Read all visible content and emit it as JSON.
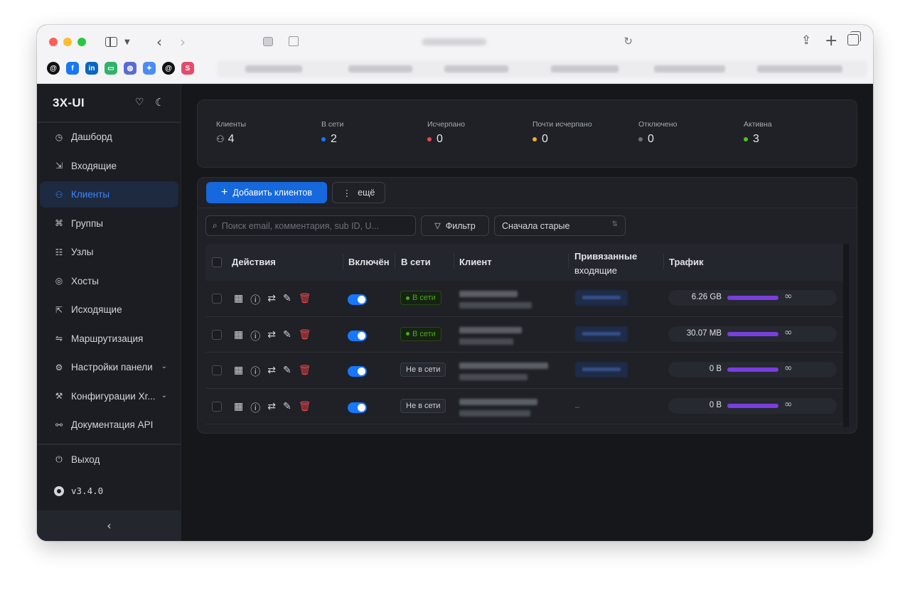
{
  "browser": {
    "bookmarks": [
      {
        "icon": "threads-icon",
        "color": "#111111",
        "glyph": "@"
      },
      {
        "icon": "facebook-icon",
        "color": "#1877f2",
        "glyph": "f"
      },
      {
        "icon": "linkedin-icon",
        "color": "#0a66c2",
        "glyph": "in"
      },
      {
        "icon": "chat-icon",
        "color": "#2fb36a",
        "glyph": "▭"
      },
      {
        "icon": "globe-icon",
        "color": "#5a6bd8",
        "glyph": "◍"
      },
      {
        "icon": "gemini-icon",
        "color": "#4c8bf5",
        "glyph": "✦"
      },
      {
        "icon": "at-icon",
        "color": "#111111",
        "glyph": "@"
      },
      {
        "icon": "shortcuts-icon",
        "color": "#e24c6a",
        "glyph": "S"
      }
    ]
  },
  "app": {
    "brand": "3X-UI",
    "menu": [
      {
        "name": "dashboard",
        "label": "Дашборд",
        "icon": "◷",
        "active": false,
        "arrow": false
      },
      {
        "name": "inbounds",
        "label": "Входящие",
        "icon": "⇲",
        "active": false,
        "arrow": false
      },
      {
        "name": "clients",
        "label": "Клиенты",
        "icon": "⚇",
        "active": true,
        "arrow": false
      },
      {
        "name": "groups",
        "label": "Группы",
        "icon": "⌘",
        "active": false,
        "arrow": false
      },
      {
        "name": "nodes",
        "label": "Узлы",
        "icon": "☷",
        "active": false,
        "arrow": false
      },
      {
        "name": "hosts",
        "label": "Хосты",
        "icon": "◎",
        "active": false,
        "arrow": false
      },
      {
        "name": "outbounds",
        "label": "Исходящие",
        "icon": "⇱",
        "active": false,
        "arrow": false
      },
      {
        "name": "routing",
        "label": "Маршрутизация",
        "icon": "⇋",
        "active": false,
        "arrow": false
      },
      {
        "name": "panel-settings",
        "label": "Настройки панели",
        "icon": "⚙",
        "active": false,
        "arrow": true
      },
      {
        "name": "xray-configs",
        "label": "Конфигурации Xr...",
        "icon": "⚒",
        "active": false,
        "arrow": true
      },
      {
        "name": "api-docs",
        "label": "Документация API",
        "icon": "⚯",
        "active": false,
        "arrow": false
      }
    ],
    "exit_label": "Выход",
    "version": "v3.4.0"
  },
  "stats": [
    {
      "label": "Клиенты",
      "value": "4",
      "kind": "icon",
      "color": ""
    },
    {
      "label": "В сети",
      "value": "2",
      "kind": "dot",
      "color": "#1677ff"
    },
    {
      "label": "Исчерпано",
      "value": "0",
      "kind": "dot",
      "color": "#e5484d"
    },
    {
      "label": "Почти исчерпано",
      "value": "0",
      "kind": "dot",
      "color": "#faad14"
    },
    {
      "label": "Отключено",
      "value": "0",
      "kind": "dot",
      "color": "#6d7179"
    },
    {
      "label": "Активна",
      "value": "3",
      "kind": "dot",
      "color": "#52c41a"
    }
  ],
  "toolbar": {
    "add_label": "Добавить клиентов",
    "more_label": "ещё",
    "search_placeholder": "Поиск email, комментария, sub ID, U...",
    "filter_label": "Фильтр",
    "sort_value": "Сначала старые"
  },
  "table": {
    "headers": {
      "actions": "Действия",
      "enabled": "Включён",
      "online": "В сети",
      "client": "Клиент",
      "inbounds_1": "Привязанные",
      "inbounds_2": "входящие",
      "traffic": "Трафик"
    },
    "rows": [
      {
        "enabled": true,
        "status": "В сети",
        "online": true,
        "inbound": true,
        "traffic": "6.26 GB",
        "traffic_limit": "∞"
      },
      {
        "enabled": true,
        "status": "В сети",
        "online": true,
        "inbound": true,
        "traffic": "30.07 MB",
        "traffic_limit": "∞"
      },
      {
        "enabled": true,
        "status": "Не в сети",
        "online": false,
        "inbound": true,
        "traffic": "0 B",
        "traffic_limit": "∞"
      },
      {
        "enabled": true,
        "status": "Не в сети",
        "online": false,
        "inbound": false,
        "traffic": "0 B",
        "traffic_limit": "∞"
      }
    ],
    "no_inbound_text": "–"
  }
}
